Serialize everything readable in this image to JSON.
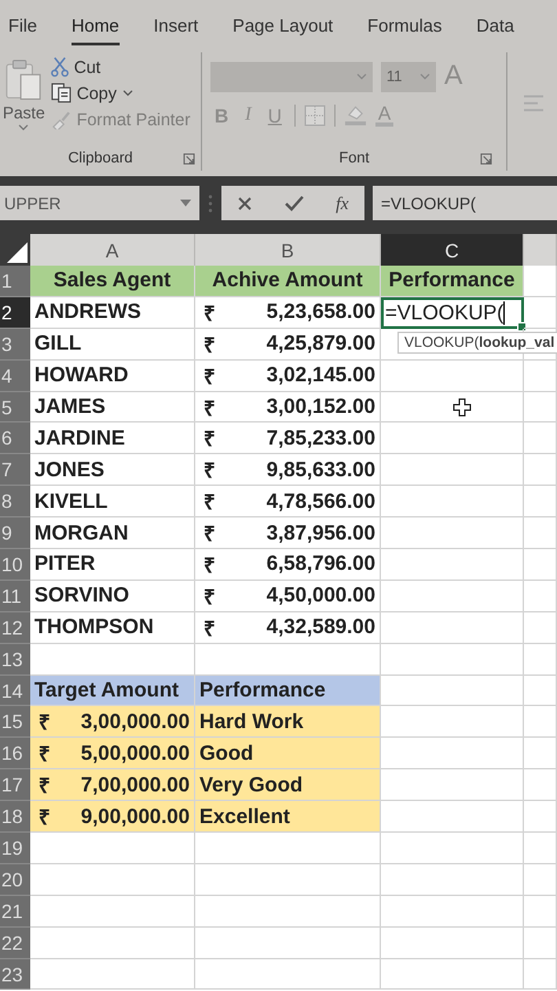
{
  "tabs": [
    {
      "label": "File",
      "selected": false
    },
    {
      "label": "Home",
      "selected": true
    },
    {
      "label": "Insert",
      "selected": false
    },
    {
      "label": "Page Layout",
      "selected": false
    },
    {
      "label": "Formulas",
      "selected": false
    },
    {
      "label": "Data",
      "selected": false
    }
  ],
  "clipboard": {
    "paste": "Paste",
    "cut": "Cut",
    "copy": "Copy",
    "format_painter": "Format Painter",
    "group_label": "Clipboard"
  },
  "font": {
    "disabled": true,
    "size": "11",
    "grow": "A",
    "bold": "B",
    "italic": "I",
    "underline": "U",
    "color_letter": "A",
    "group_label": "Font"
  },
  "name_box": "UPPER",
  "fx": "fx",
  "formula": "=VLOOKUP(",
  "columns": [
    {
      "label": "A",
      "selected": false
    },
    {
      "label": "B",
      "selected": false
    },
    {
      "label": "C",
      "selected": true
    }
  ],
  "rows": [
    {
      "number": "1",
      "selected": false,
      "cells": [
        {
          "kind": "text",
          "color": "#a9d08e",
          "centered": true,
          "text": "Sales Agent"
        },
        {
          "kind": "text",
          "color": "#a9d08e",
          "centered": true,
          "text": "Achive Amount"
        },
        {
          "kind": "text",
          "color": "#a9d08e",
          "centered": true,
          "text": "Performance"
        }
      ]
    },
    {
      "number": "2",
      "selected": true,
      "cells": [
        {
          "kind": "text",
          "text": "ANDREWS"
        },
        {
          "kind": "amount",
          "symbol": "₹",
          "value": "5,23,658.00"
        },
        {
          "kind": "editing",
          "text": "=VLOOKUP(",
          "tooltip": "VLOOKUP(**lookup_val**"
        }
      ]
    },
    {
      "number": "3",
      "selected": false,
      "cells": [
        {
          "kind": "text",
          "text": "GILL"
        },
        {
          "kind": "amount",
          "symbol": "₹",
          "value": "4,25,879.00"
        }
      ]
    },
    {
      "number": "4",
      "selected": false,
      "cells": [
        {
          "kind": "text",
          "text": "HOWARD"
        },
        {
          "kind": "amount",
          "symbol": "₹",
          "value": "3,02,145.00"
        }
      ]
    },
    {
      "number": "5",
      "selected": false,
      "cells": [
        {
          "kind": "text",
          "text": "JAMES"
        },
        {
          "kind": "amount",
          "symbol": "₹",
          "value": "3,00,152.00"
        }
      ]
    },
    {
      "number": "6",
      "selected": false,
      "cells": [
        {
          "kind": "text",
          "text": "JARDINE"
        },
        {
          "kind": "amount",
          "symbol": "₹",
          "value": "7,85,233.00"
        }
      ]
    },
    {
      "number": "7",
      "selected": false,
      "cells": [
        {
          "kind": "text",
          "text": "JONES"
        },
        {
          "kind": "amount",
          "symbol": "₹",
          "value": "9,85,633.00"
        }
      ]
    },
    {
      "number": "8",
      "selected": false,
      "cells": [
        {
          "kind": "text",
          "text": "KIVELL"
        },
        {
          "kind": "amount",
          "symbol": "₹",
          "value": "4,78,566.00"
        }
      ]
    },
    {
      "number": "9",
      "selected": false,
      "cells": [
        {
          "kind": "text",
          "text": "MORGAN"
        },
        {
          "kind": "amount",
          "symbol": "₹",
          "value": "3,87,956.00"
        }
      ]
    },
    {
      "number": "10",
      "selected": false,
      "cells": [
        {
          "kind": "text",
          "text": "PITER"
        },
        {
          "kind": "amount",
          "symbol": "₹",
          "value": "6,58,796.00"
        }
      ]
    },
    {
      "number": "11",
      "selected": false,
      "cells": [
        {
          "kind": "text",
          "text": "SORVINO"
        },
        {
          "kind": "amount",
          "symbol": "₹",
          "value": "4,50,000.00"
        }
      ]
    },
    {
      "number": "12",
      "selected": false,
      "cells": [
        {
          "kind": "text",
          "text": "THOMPSON"
        },
        {
          "kind": "amount",
          "symbol": "₹",
          "value": "4,32,589.00"
        }
      ]
    },
    {
      "number": "13",
      "selected": false
    },
    {
      "number": "14",
      "selected": false,
      "cells": [
        {
          "kind": "text",
          "color": "#b4c6e7",
          "text": "Target Amount"
        },
        {
          "kind": "text",
          "color": "#b4c6e7",
          "text": "Performance"
        }
      ]
    },
    {
      "number": "15",
      "selected": false,
      "cells": [
        {
          "kind": "amount",
          "color": "#ffe699",
          "symbol": "₹",
          "value": "3,00,000.00"
        },
        {
          "kind": "text",
          "color": "#ffe699",
          "text": "Hard Work"
        }
      ]
    },
    {
      "number": "16",
      "selected": false,
      "cells": [
        {
          "kind": "amount",
          "color": "#ffe699",
          "symbol": "₹",
          "value": "5,00,000.00"
        },
        {
          "kind": "text",
          "color": "#ffe699",
          "text": "Good"
        }
      ]
    },
    {
      "number": "17",
      "selected": false,
      "cells": [
        {
          "kind": "amount",
          "color": "#ffe699",
          "symbol": "₹",
          "value": "7,00,000.00"
        },
        {
          "kind": "text",
          "color": "#ffe699",
          "text": "Very Good"
        }
      ]
    },
    {
      "number": "18",
      "selected": false,
      "cells": [
        {
          "kind": "amount",
          "color": "#ffe699",
          "symbol": "₹",
          "value": "9,00,000.00"
        },
        {
          "kind": "text",
          "color": "#ffe699",
          "text": "Excellent"
        }
      ]
    },
    {
      "number": "19",
      "selected": false
    },
    {
      "number": "20",
      "selected": false
    },
    {
      "number": "21",
      "selected": false
    },
    {
      "number": "22",
      "selected": false
    },
    {
      "number": "23",
      "selected": false
    }
  ]
}
